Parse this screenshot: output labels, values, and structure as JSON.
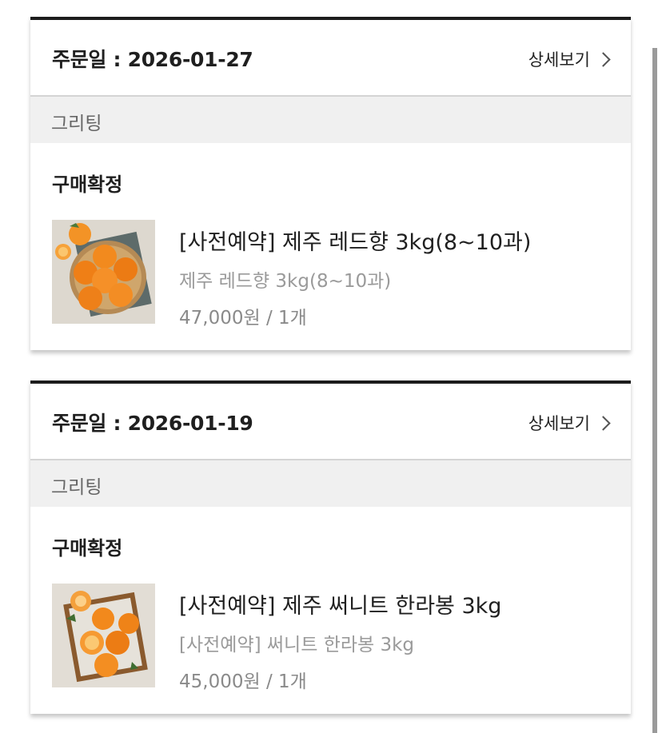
{
  "orders": [
    {
      "order_date_label": "주문일 : 2026-01-27",
      "detail_label": "상세보기",
      "seller": "그리팅",
      "status": "구매확정",
      "product_title": "[사전예약] 제주 레드향 3kg(8~10과)",
      "product_option": "제주 레드향 3kg(8~10과)",
      "price_qty": "47,000원 / 1개",
      "image_icon": "red-hyang-oranges-basket"
    },
    {
      "order_date_label": "주문일 : 2026-01-19",
      "detail_label": "상세보기",
      "seller": "그리팅",
      "status": "구매확정",
      "product_title": "[사전예약] 제주 써니트 한라봉 3kg",
      "product_option": "[사전예약] 써니트 한라봉 3kg",
      "price_qty": "45,000원 / 1개",
      "image_icon": "hallabong-oranges-box"
    }
  ],
  "colors": {
    "card_top_border": "#1c1c1c",
    "seller_row_bg": "#f0f0f0",
    "muted_text": "#9a9a9a",
    "orange": "#f08a1c"
  }
}
